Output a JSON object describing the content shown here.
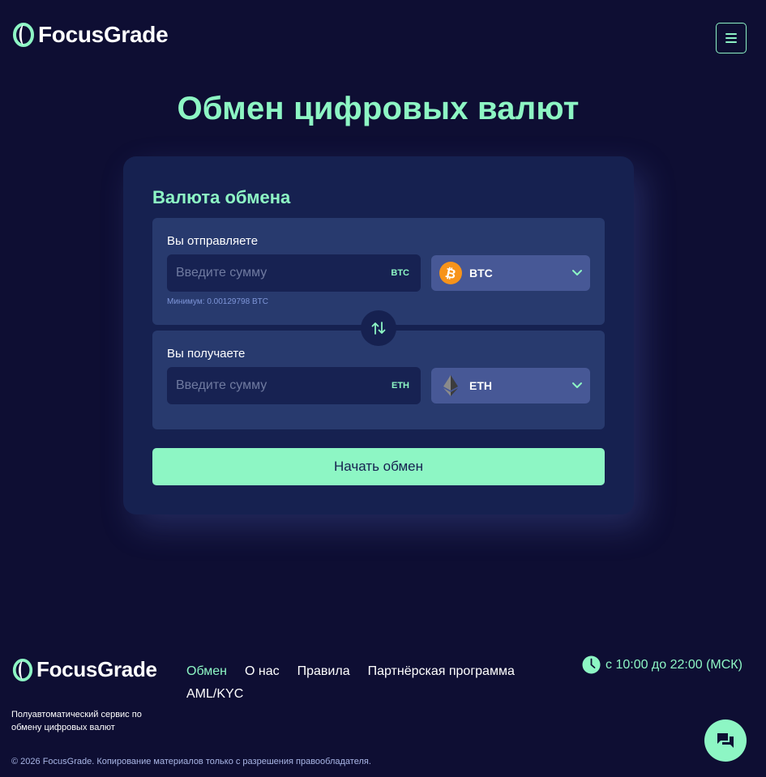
{
  "brand": {
    "name": "FocusGrade"
  },
  "header": {
    "menu_icon": "hamburger-menu-icon"
  },
  "page": {
    "title": "Обмен цифровых валют"
  },
  "exchange": {
    "title": "Валюта обмена",
    "send": {
      "label": "Вы отправляете",
      "placeholder": "Введите сумму",
      "unit": "BTC",
      "currency": "BTC",
      "currency_icon": "bitcoin-icon",
      "minimum": "Минимум: 0.00129798 BTC"
    },
    "receive": {
      "label": "Вы получаете",
      "placeholder": "Введите сумму",
      "unit": "ETH",
      "currency": "ETH",
      "currency_icon": "ethereum-icon"
    },
    "swap_icon": "swap-arrows-icon",
    "start_label": "Начать обмен"
  },
  "footer": {
    "nav": [
      {
        "label": "Обмен",
        "active": true
      },
      {
        "label": "О нас",
        "active": false
      },
      {
        "label": "Правила",
        "active": false
      },
      {
        "label": "Партнёрская программа",
        "active": false
      },
      {
        "label": "AML/KYC",
        "active": false
      }
    ],
    "hours": "с 10:00 до 22:00 (МСК)",
    "description": "Полуавтоматический сервис по обмену цифровых валют",
    "copyright": "© 2026 FocusGrade. Копирование материалов только с разрешения правообладателя."
  },
  "colors": {
    "background": "#0e0e33",
    "accent": "#8df6c4",
    "card": "#162150",
    "panel": "#283a6e",
    "select": "#475896",
    "bitcoin": "#f7931a"
  }
}
